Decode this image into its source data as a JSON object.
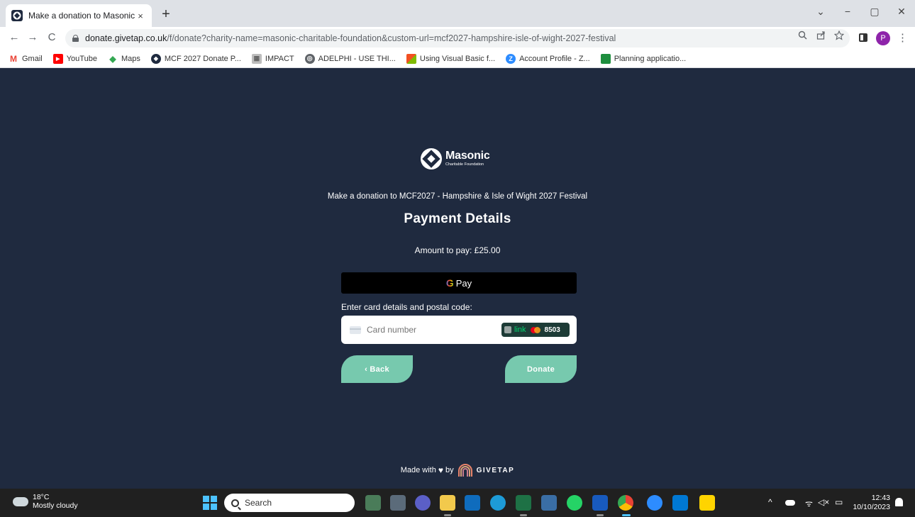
{
  "browser": {
    "tab_title": "Make a donation to Masonic Ch",
    "tab_close": "×",
    "new_tab": "+",
    "window_controls": {
      "chevron": "⌄",
      "minimize": "−",
      "restore": "▢",
      "close": "✕"
    },
    "nav": {
      "back": "←",
      "forward": "→",
      "reload": "C"
    },
    "url_host": "donate.givetap.co.uk",
    "url_rest": "/f/donate?charity-name=masonic-charitable-foundation&custom-url=mcf2027-hampshire-isle-of-wight-2027-festival",
    "profile_initial": "P",
    "bookmarks": [
      {
        "label": "Gmail",
        "icon": "gmail-icon",
        "color": "#ea4335",
        "glyph": "M"
      },
      {
        "label": "YouTube",
        "icon": "youtube-icon",
        "color": "#ff0000",
        "glyph": "▶"
      },
      {
        "label": "Maps",
        "icon": "maps-icon",
        "color": "#34a853",
        "glyph": "◆"
      },
      {
        "label": "MCF 2027 Donate P...",
        "icon": "masonic-icon",
        "color": "#1f2a3f",
        "glyph": "◆"
      },
      {
        "label": "IMPACT",
        "icon": "impact-icon",
        "color": "#9e9e9e",
        "glyph": "▦"
      },
      {
        "label": "ADELPHI - USE THI...",
        "icon": "globe-icon",
        "color": "#5f6368",
        "glyph": "◎"
      },
      {
        "label": "Using Visual Basic f...",
        "icon": "microsoft-icon",
        "color": "#f25022",
        "glyph": "■"
      },
      {
        "label": "Account Profile - Z...",
        "icon": "zoom-icon",
        "color": "#2d8cff",
        "glyph": "Z"
      },
      {
        "label": "Planning applicatio...",
        "icon": "planning-icon",
        "color": "#1e8e3e",
        "glyph": "■"
      }
    ]
  },
  "page": {
    "logo_name": "Masonic",
    "logo_sub": "Charitable Foundation",
    "donation_title": "Make a donation to MCF2027 - Hampshire & Isle of Wight 2027 Festival",
    "heading": "Payment Details",
    "amount": "Amount to pay: £25.00",
    "gpay_g": "G",
    "gpay_label": "Pay",
    "card_label": "Enter card details and postal code:",
    "card_placeholder": "Card number",
    "link_word": "link",
    "link_last4": "8503",
    "back_label": "‹ Back",
    "donate_label": "Donate",
    "footer_made": "Made with",
    "footer_by": "by",
    "footer_brand": "GIVETAP",
    "accent_color": "#77c9ae",
    "background_color": "#1f2a3f"
  },
  "taskbar": {
    "temperature": "18°C",
    "weather": "Mostly cloudy",
    "search_label": "Search",
    "time": "12:43",
    "date": "10/10/2023",
    "tray": {
      "chevron": "^",
      "wifi": "ᯤ",
      "sound": "◁×",
      "battery": "▭"
    }
  }
}
